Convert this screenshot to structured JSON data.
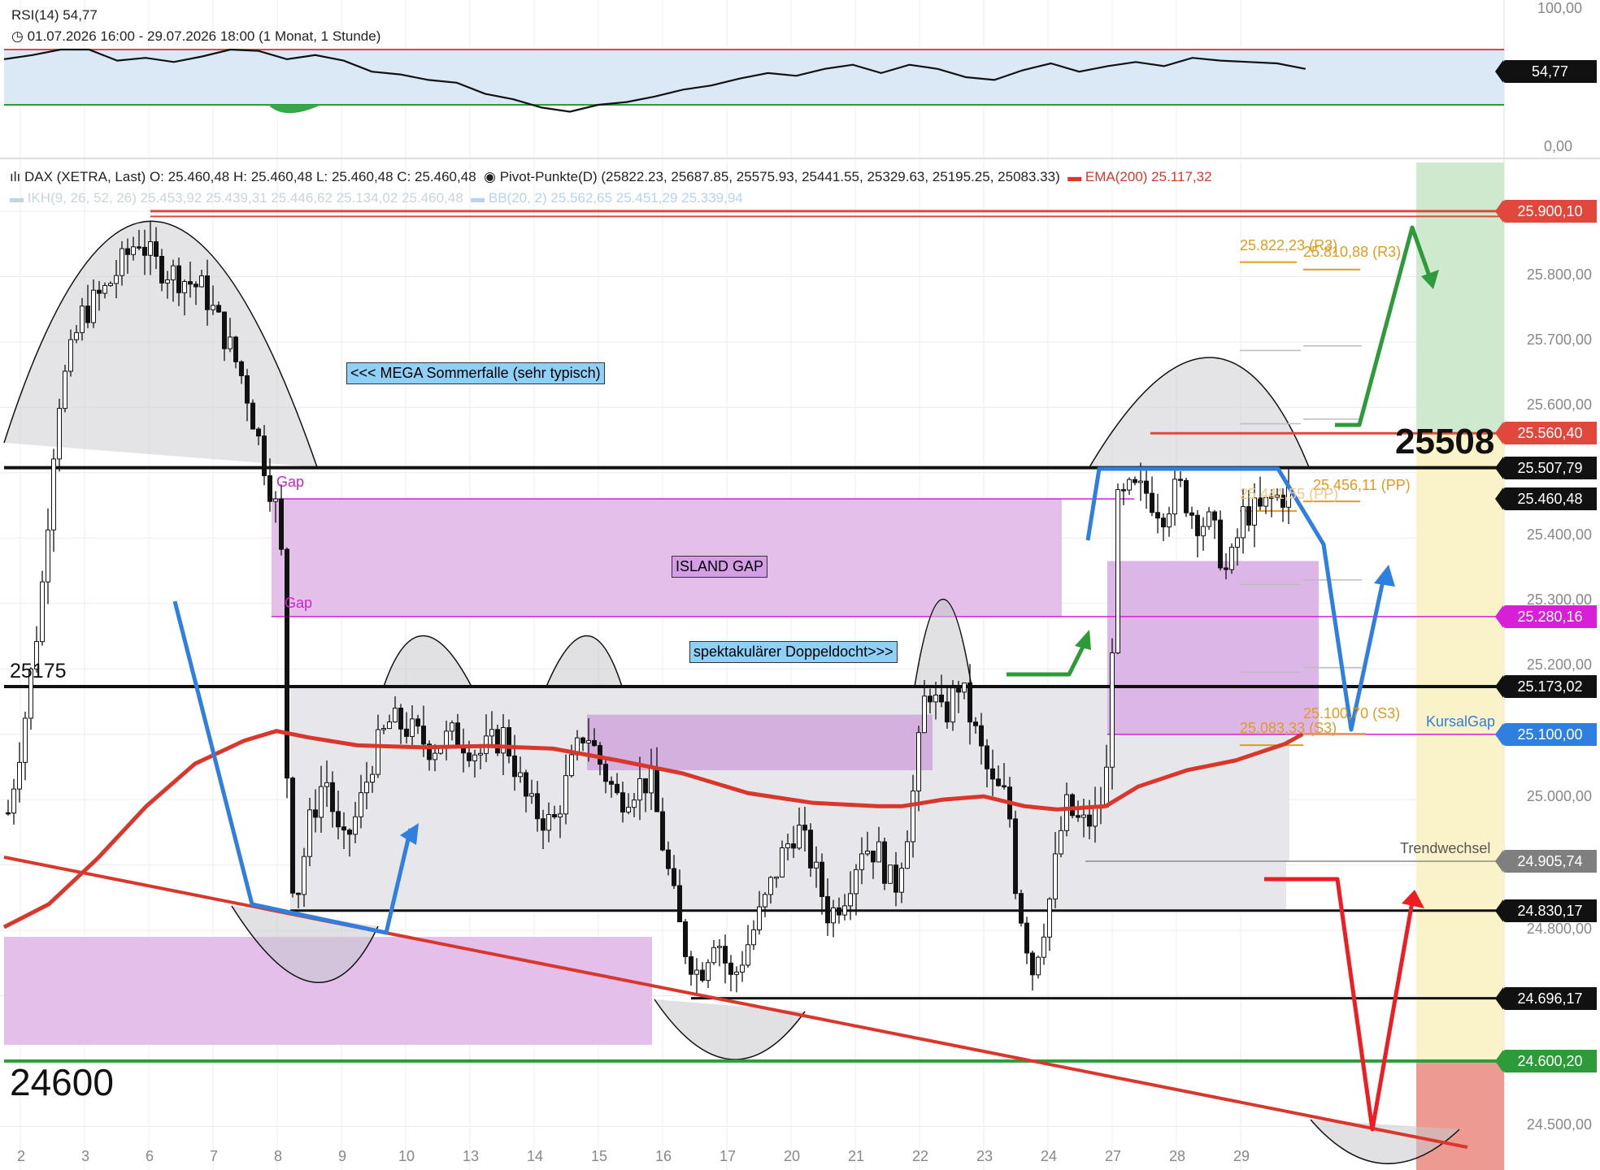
{
  "rsi_header": {
    "title": "RSI(14)  54,77",
    "range": "01.07.2026 16:00 - 29.07.2026 18:00  (1 Monat, 1 Stunde)",
    "axis_top": "100,00",
    "axis_bottom": "0,00",
    "value_badge": "54,77"
  },
  "main_header": {
    "line1_main": "DAX (XETRA, Last)  O: 25.460,48  H: 25.460,48  L: 25.460,48  C: 25.460,48",
    "line1_pivot": "Pivot-Punkte(D)  (25822.23,  25687.85,  25575.93,  25441.55,  25329.63,  25195.25,  25083.33)",
    "line1_ema": "EMA(200)  25.117,32",
    "line2_ikh": "IKH(9, 26, 52, 26)  25.453,92  25.439,31  25.446,62  25.134,02  25.460,48",
    "line2_bb": "BB(20, 2)  25.562,65  25.451,29  25.339,94"
  },
  "y_axis_labels": [
    "25.800,00",
    "25.700,00",
    "25.600,00",
    "25.400,00",
    "25.300,00",
    "25.200,00",
    "25.000,00",
    "24.800,00",
    "24.500,00"
  ],
  "x_axis_labels": [
    "2",
    "3",
    "6",
    "7",
    "8",
    "9",
    "10",
    "13",
    "14",
    "15",
    "16",
    "17",
    "20",
    "21",
    "22",
    "23",
    "24",
    "27",
    "28",
    "29"
  ],
  "price_badges": [
    {
      "label": "25.900,10",
      "price": 25900.1,
      "color": "#e2473b"
    },
    {
      "label": "25.560,40",
      "price": 25560.4,
      "color": "#e2473b"
    },
    {
      "label": "25.507,79",
      "price": 25507.79,
      "color": "#111111"
    },
    {
      "label": "25.460,48",
      "price": 25460.48,
      "color": "#111111"
    },
    {
      "label": "25.280,16",
      "price": 25280.16,
      "color": "#d61fd6"
    },
    {
      "label": "25.173,02",
      "price": 25173.02,
      "color": "#111111"
    },
    {
      "label": "25.100,00",
      "price": 25100.0,
      "color": "#2f7fe0"
    },
    {
      "label": "24.905,74",
      "price": 24905.74,
      "color": "#7f7f7f"
    },
    {
      "label": "24.830,17",
      "price": 24830.17,
      "color": "#111111"
    },
    {
      "label": "24.696,17",
      "price": 24696.17,
      "color": "#111111"
    },
    {
      "label": "24.600,20",
      "price": 24600.2,
      "color": "#2e9b3a"
    }
  ],
  "annotations": {
    "mega": "<<< MEGA Sommerfalle (sehr typisch)",
    "island": "ISLAND GAP",
    "doppel": "spektakulärer Doppeldocht>>>",
    "gap1": "Gap",
    "gap2": "Gap",
    "big_25175": "25175",
    "big_24600": "24600",
    "big_25508": "25508",
    "r3a": "25.822,23 (R3)",
    "r3b": "25.810,88 (R3)",
    "pp1": "25.456,11 (PP)",
    "pp2": "25.441,55 (PP)",
    "s3a": "25.100,70 (S3)",
    "s3b": "25.083,33 (S3)",
    "trend": "Trendwechsel",
    "kurs": "KursalGap"
  },
  "chart_data": {
    "type": "candlestick",
    "symbol": "DAX (XETRA, Last)",
    "interval": "1 Stunde",
    "period": "01.07.2026 16:00 - 29.07.2026 18:00",
    "ohlc_last": {
      "open": 25460.48,
      "high": 25460.48,
      "low": 25460.48,
      "close": 25460.48
    },
    "rsi": {
      "period": 14,
      "last": 54.77,
      "range": [
        0,
        100
      ],
      "points": [
        [
          0.0,
          63
        ],
        [
          0.02,
          66
        ],
        [
          0.04,
          70
        ],
        [
          0.06,
          70
        ],
        [
          0.08,
          62
        ],
        [
          0.1,
          64
        ],
        [
          0.12,
          61
        ],
        [
          0.14,
          65
        ],
        [
          0.16,
          70
        ],
        [
          0.18,
          69
        ],
        [
          0.2,
          63
        ],
        [
          0.22,
          66
        ],
        [
          0.24,
          62
        ],
        [
          0.26,
          54
        ],
        [
          0.28,
          52
        ],
        [
          0.3,
          48
        ],
        [
          0.32,
          46
        ],
        [
          0.34,
          38
        ],
        [
          0.36,
          34
        ],
        [
          0.38,
          28
        ],
        [
          0.4,
          25
        ],
        [
          0.42,
          30
        ],
        [
          0.44,
          32
        ],
        [
          0.46,
          36
        ],
        [
          0.48,
          41
        ],
        [
          0.5,
          44
        ],
        [
          0.52,
          49
        ],
        [
          0.54,
          53
        ],
        [
          0.56,
          51
        ],
        [
          0.58,
          56
        ],
        [
          0.6,
          59
        ],
        [
          0.62,
          53
        ],
        [
          0.64,
          59
        ],
        [
          0.66,
          56
        ],
        [
          0.68,
          50
        ],
        [
          0.7,
          48
        ],
        [
          0.72,
          55
        ],
        [
          0.74,
          60
        ],
        [
          0.76,
          54
        ],
        [
          0.78,
          58
        ],
        [
          0.8,
          61
        ],
        [
          0.82,
          58
        ],
        [
          0.84,
          64
        ],
        [
          0.86,
          62
        ],
        [
          0.88,
          61
        ],
        [
          0.9,
          60
        ],
        [
          0.92,
          56
        ]
      ]
    },
    "pivot_points_d": [
      25822.23,
      25687.85,
      25575.93,
      25441.55,
      25329.63,
      25195.25,
      25083.33
    ],
    "ema200": 25117.32,
    "ikh": [
      25453.92,
      25439.31,
      25446.62,
      25134.02,
      25460.48
    ],
    "bollinger": [
      25562.65,
      25451.29,
      25339.94
    ],
    "y_range": [
      24430,
      25930
    ],
    "horizontal_levels": [
      25900.1,
      25560.4,
      25507.79,
      25280.16,
      25173.02,
      25100.0,
      24905.74,
      24830.17,
      24696.17,
      24600.2
    ]
  }
}
